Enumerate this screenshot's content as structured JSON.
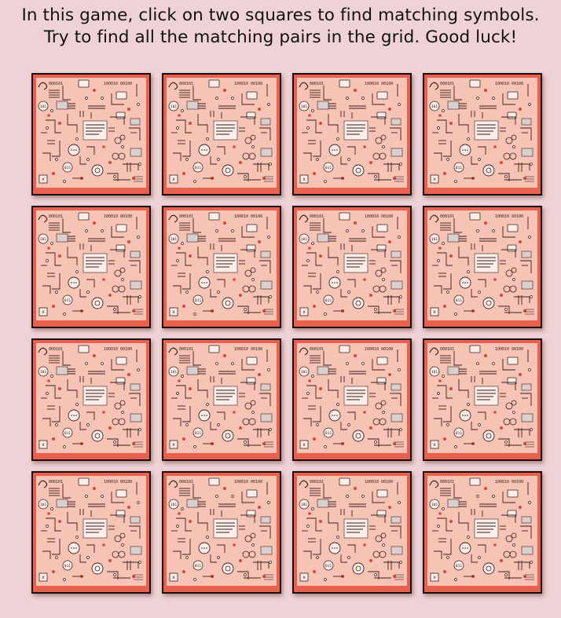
{
  "instructions": {
    "line1": "In this game, click on two squares to find matching symbols.",
    "line2": "Try to find all the matching pairs in the grid. Good luck!"
  },
  "colors": {
    "background": "#efd2d5",
    "card_border": "#1a0f0f",
    "card_frame": "#e8604e",
    "card_face": "#f6c3b4",
    "circuit_dark": "#3a2020",
    "circuit_red": "#d9493a",
    "circuit_white": "#fbeee9"
  },
  "card_back_icon": "circuit-board-pattern",
  "card_back_text": {
    "top_left": "000101",
    "top_right": "100010 00100",
    "badge_101": "101",
    "badge_011": "011",
    "badge_x": "x"
  },
  "grid": {
    "rows": 4,
    "columns": 4,
    "cards": [
      {
        "row": 1,
        "col": 1,
        "state": "face-down"
      },
      {
        "row": 1,
        "col": 2,
        "state": "face-down"
      },
      {
        "row": 1,
        "col": 3,
        "state": "face-down"
      },
      {
        "row": 1,
        "col": 4,
        "state": "face-down"
      },
      {
        "row": 2,
        "col": 1,
        "state": "face-down"
      },
      {
        "row": 2,
        "col": 2,
        "state": "face-down"
      },
      {
        "row": 2,
        "col": 3,
        "state": "face-down"
      },
      {
        "row": 2,
        "col": 4,
        "state": "face-down"
      },
      {
        "row": 3,
        "col": 1,
        "state": "face-down"
      },
      {
        "row": 3,
        "col": 2,
        "state": "face-down"
      },
      {
        "row": 3,
        "col": 3,
        "state": "face-down"
      },
      {
        "row": 3,
        "col": 4,
        "state": "face-down"
      },
      {
        "row": 4,
        "col": 1,
        "state": "face-down"
      },
      {
        "row": 4,
        "col": 2,
        "state": "face-down"
      },
      {
        "row": 4,
        "col": 3,
        "state": "face-down"
      },
      {
        "row": 4,
        "col": 4,
        "state": "face-down"
      }
    ]
  }
}
